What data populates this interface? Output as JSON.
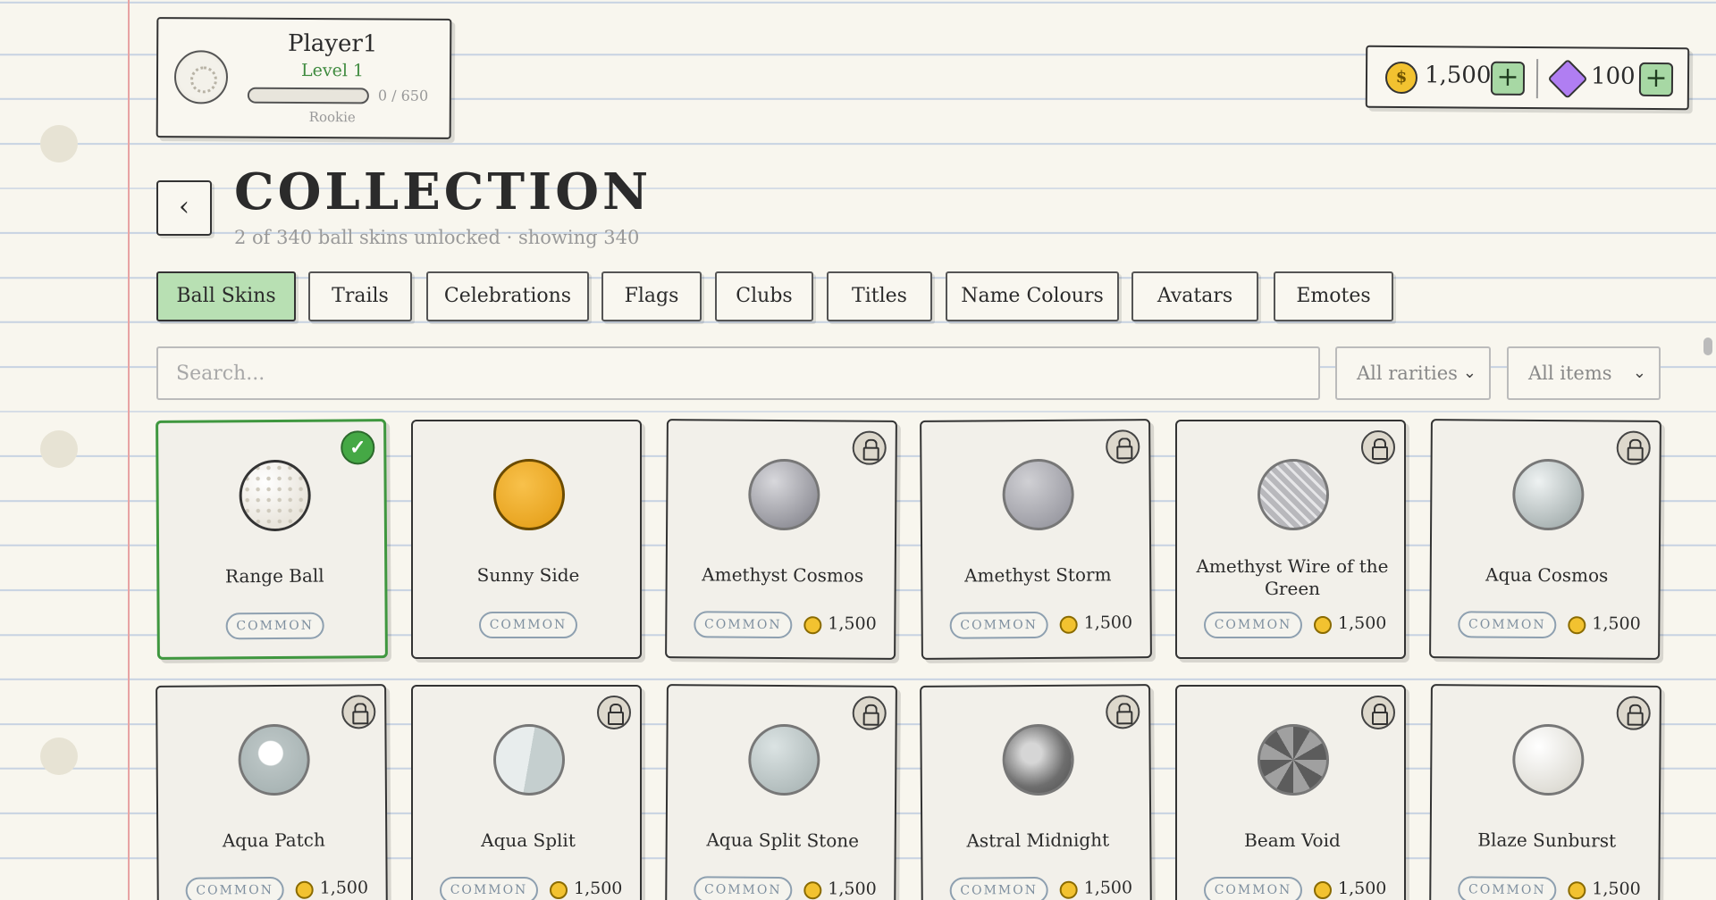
{
  "profile": {
    "name": "Player1",
    "level": "Level 1",
    "xp_text": "0 / 650",
    "xp_progress": 0,
    "rank": "Rookie"
  },
  "currency": {
    "coins": "1,500",
    "coins_add": "+",
    "gems": "100",
    "gems_add": "+"
  },
  "header": {
    "back": "‹",
    "title": "COLLECTION",
    "subtitle": "2 of 340 ball skins unlocked · showing 340"
  },
  "tabs": [
    {
      "label": "Ball Skins",
      "active": true
    },
    {
      "label": "Trails"
    },
    {
      "label": "Celebrations"
    },
    {
      "label": "Flags"
    },
    {
      "label": "Clubs"
    },
    {
      "label": "Titles"
    },
    {
      "label": "Name Colours"
    },
    {
      "label": "Avatars"
    },
    {
      "label": "Emotes"
    }
  ],
  "filters": {
    "search_placeholder": "Search...",
    "rarity": "All rarities",
    "items": "All items",
    "chevron": "⌄"
  },
  "items": [
    {
      "name": "Range Ball",
      "rarity": "COMMON",
      "status": "equipped"
    },
    {
      "name": "Sunny Side",
      "rarity": "COMMON",
      "status": "owned"
    },
    {
      "name": "Amethyst Cosmos",
      "rarity": "COMMON",
      "price": "1,500",
      "status": "locked"
    },
    {
      "name": "Amethyst Storm",
      "rarity": "COMMON",
      "price": "1,500",
      "status": "locked"
    },
    {
      "name": "Amethyst Wire of the Green",
      "rarity": "COMMON",
      "price": "1,500",
      "status": "locked"
    },
    {
      "name": "Aqua Cosmos",
      "rarity": "COMMON",
      "price": "1,500",
      "status": "locked"
    },
    {
      "name": "Aqua Patch",
      "rarity": "COMMON",
      "price": "1,500",
      "status": "locked"
    },
    {
      "name": "Aqua Split",
      "rarity": "COMMON",
      "price": "1,500",
      "status": "locked"
    },
    {
      "name": "Aqua Split Stone",
      "rarity": "COMMON",
      "price": "1,500",
      "status": "locked"
    },
    {
      "name": "Astral Midnight",
      "rarity": "COMMON",
      "price": "1,500",
      "status": "locked"
    },
    {
      "name": "Beam Void",
      "rarity": "COMMON",
      "price": "1,500",
      "status": "locked"
    },
    {
      "name": "Blaze Sunburst",
      "rarity": "COMMON",
      "price": "1,500",
      "status": "locked"
    }
  ],
  "colors": {
    "accent_green": "#3f973f",
    "coin_gold": "#f2c230",
    "gem_purple": "#b07ef2",
    "margin_red": "#e8a3a3"
  }
}
